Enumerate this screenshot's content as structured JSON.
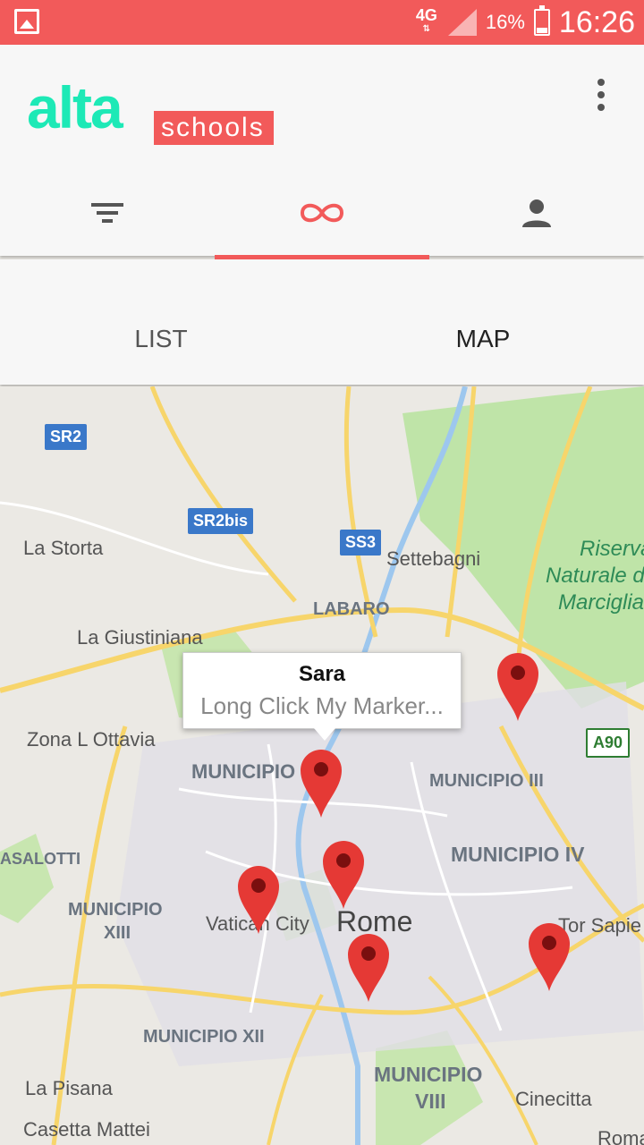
{
  "status": {
    "network": "4G",
    "battery": "16%",
    "time": "16:26"
  },
  "app": {
    "logo_main": "alta",
    "logo_sub": "schools"
  },
  "nav": {
    "tabs": [
      "filter",
      "connections",
      "profile"
    ]
  },
  "subtabs": {
    "list": "LIST",
    "map": "MAP"
  },
  "map": {
    "infowindow": {
      "title": "Sara",
      "subtitle": "Long Click My Marker..."
    },
    "labels": {
      "la_storta": "La Storta",
      "settebagni": "Settebagni",
      "labaro": "LABARO",
      "la_giustiniana": "La Giustiniana",
      "zona_ottavia": "Zona L Ottavia",
      "municipio_xiv": "MUNICIPIO",
      "municipio_iii": "MUNICIPIO III",
      "municipio_iv": "MUNICIPIO IV",
      "asalotti": "ASALOTTI",
      "municipio_xiii_a": "MUNICIPIO",
      "municipio_xiii_b": "XIII",
      "vatican": "Vatican City",
      "rome": "Rome",
      "tor_sapienza": "Tor Sapie",
      "municipio_xii": "MUNICIPIO XII",
      "la_pisana": "La Pisana",
      "casetta_mattei": "Casetta Mattei",
      "municipio_viii_a": "MUNICIPIO",
      "municipio_viii_b": "VIII",
      "cinecitta": "Cinecitta",
      "roma": "Roma",
      "riserva1": "Riserva",
      "riserva2": "Naturale d",
      "riserva3": "Marciglia"
    },
    "shields": {
      "sr2": "SR2",
      "sr2bis": "SR2bis",
      "ss3": "SS3",
      "a90": "A90"
    }
  }
}
